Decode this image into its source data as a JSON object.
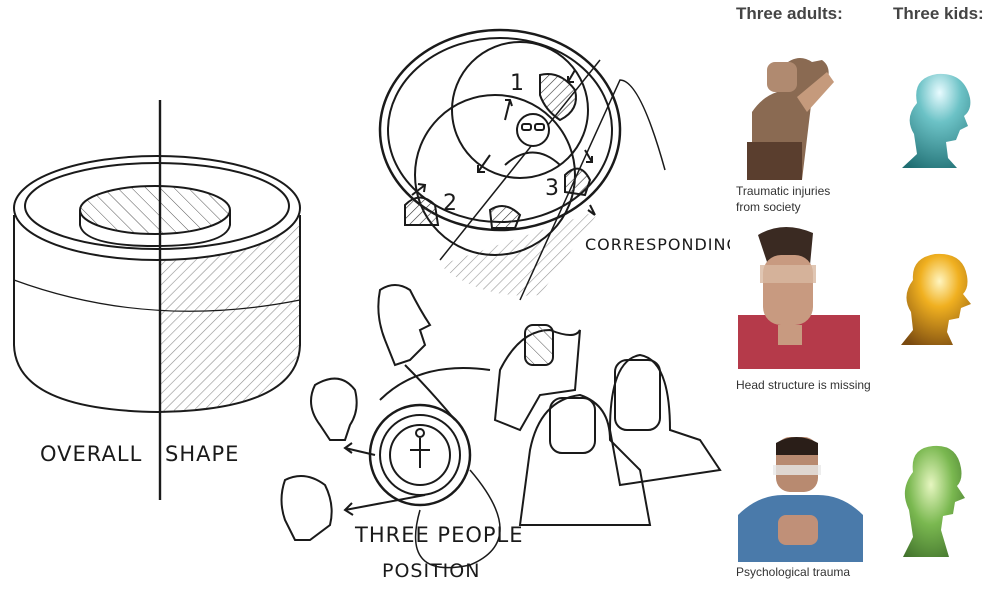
{
  "sketch": {
    "label_overall": "OVERALL",
    "label_shape": "SHAPE",
    "label_corresponding": "CORRESPONDING",
    "label_three_people": "THREE PEOPLE",
    "label_position": "POSITION",
    "num_1": "1",
    "num_2": "2",
    "num_3": "3"
  },
  "adults": {
    "heading": "Three adults:",
    "captions": [
      "Traumatic injuries\nfrom society",
      "Head structure is missing",
      "Psychological trauma"
    ]
  },
  "kids": {
    "heading": "Three kids:"
  },
  "colors": {
    "ink": "#1a1a1a",
    "heading": "#444444",
    "kid1": "#3a9aa0",
    "kid2": "#e0a020",
    "kid3": "#5a9a40"
  }
}
